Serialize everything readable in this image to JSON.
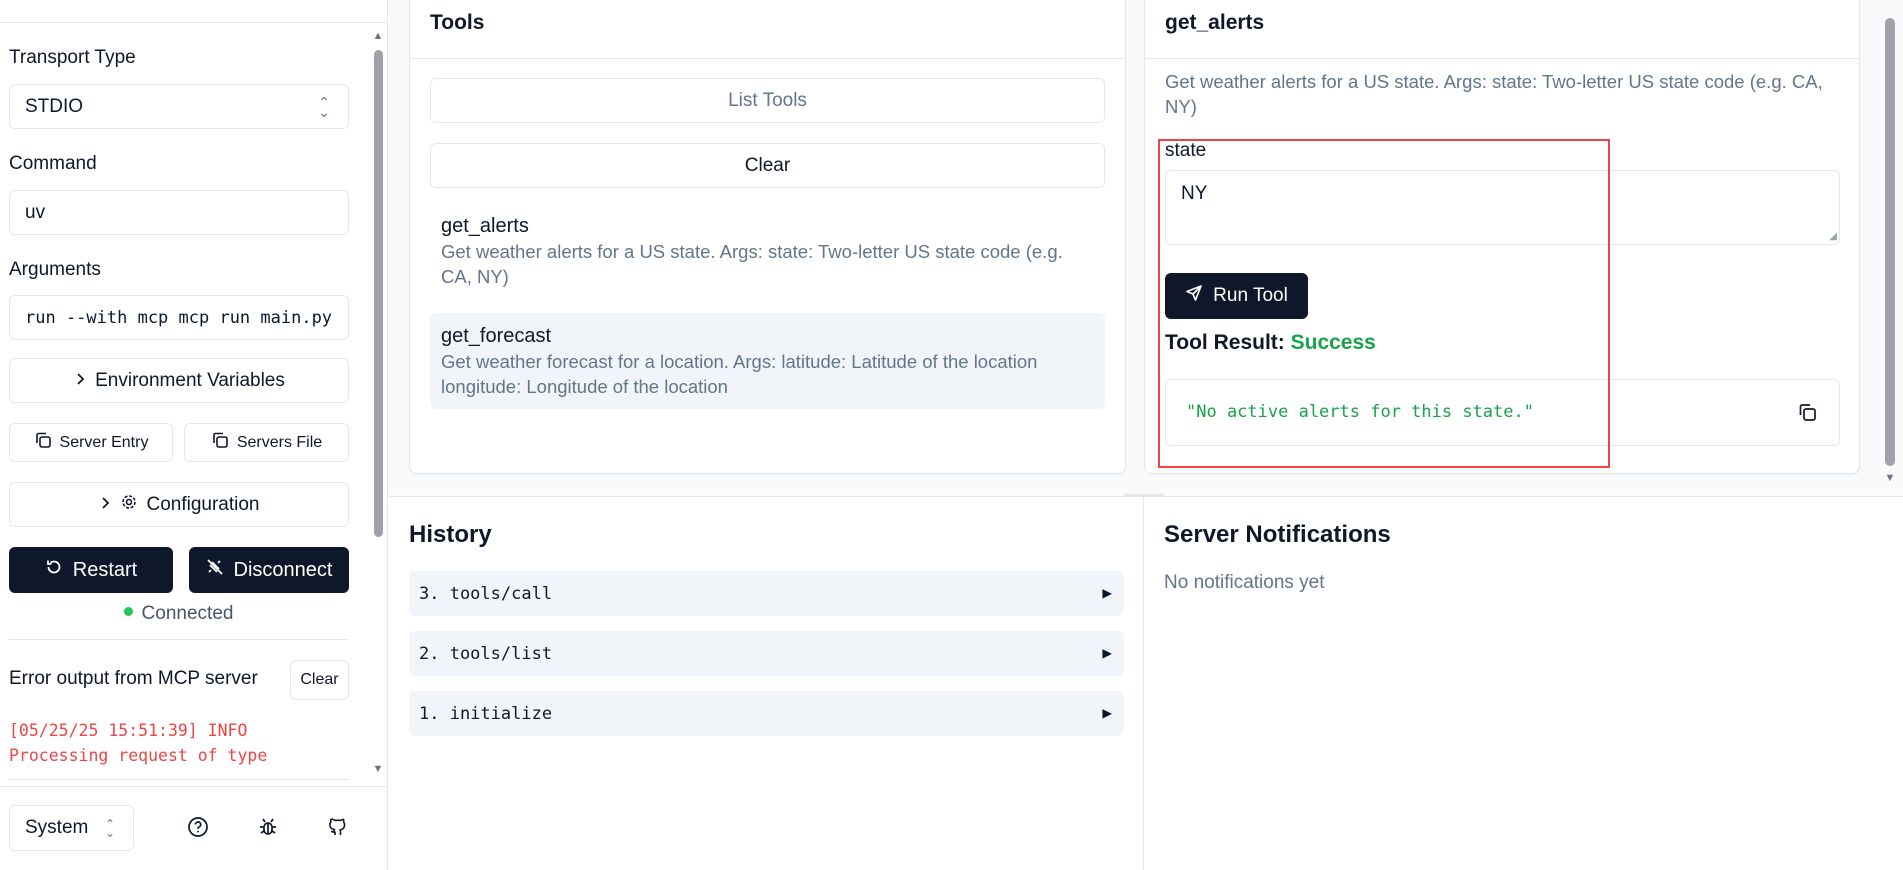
{
  "sidebar": {
    "transport_label": "Transport Type",
    "transport_value": "STDIO",
    "command_label": "Command",
    "command_value": "uv",
    "arguments_label": "Arguments",
    "arguments_value": "run --with mcp mcp run main.py",
    "env_vars_button": "Environment Variables",
    "server_entry_button": "Server Entry",
    "servers_file_button": "Servers File",
    "configuration_button": "Configuration",
    "restart_button": "Restart",
    "disconnect_button": "Disconnect",
    "status_text": "Connected",
    "error_title": "Error output from MCP server",
    "error_clear_button": "Clear",
    "error_log": "[05/25/25 15:51:39] INFO Processing request of type",
    "theme_value": "System"
  },
  "tools": {
    "title": "Tools",
    "list_button": "List Tools",
    "clear_button": "Clear",
    "items": [
      {
        "name": "get_alerts",
        "description": "Get weather alerts for a US state. Args: state: Two-letter US state code (e.g. CA, NY)"
      },
      {
        "name": "get_forecast",
        "description": "Get weather forecast for a location. Args: latitude: Latitude of the location longitude: Longitude of the location"
      }
    ]
  },
  "tool_detail": {
    "title": "get_alerts",
    "description": "Get weather alerts for a US state. Args: state: Two-letter US state code (e.g. CA, NY)",
    "param_label": "state",
    "param_value": "NY",
    "run_button": "Run Tool",
    "result_label": "Tool Result:",
    "result_status": "Success",
    "result_text": "\"No active alerts for this state.\""
  },
  "history": {
    "title": "History",
    "items": [
      "3. tools/call",
      "2. tools/list",
      "1. initialize"
    ]
  },
  "notifications": {
    "title": "Server Notifications",
    "empty_text": "No notifications yet"
  },
  "colors": {
    "primary_dark": "#0f172a",
    "success": "#16a34a",
    "status_connected": "#22c55e",
    "error": "#ef4444",
    "highlight_box": "#ef4444"
  }
}
